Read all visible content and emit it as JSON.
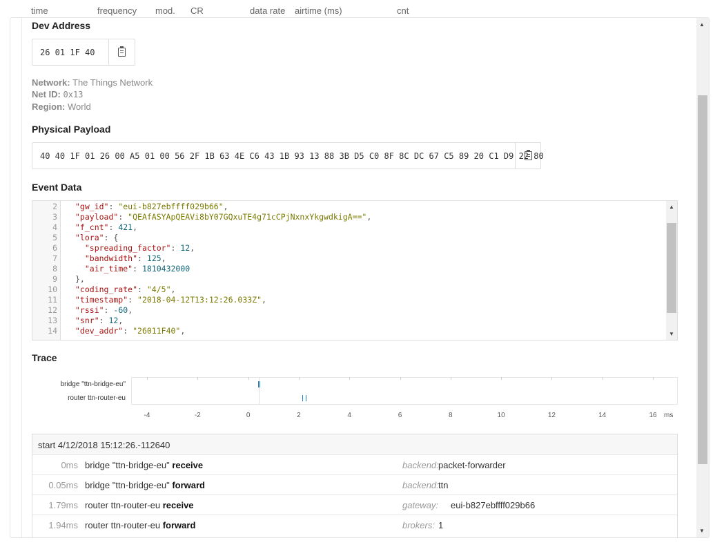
{
  "columns": [
    "time",
    "frequency",
    "mod.",
    "CR",
    "data rate",
    "airtime (ms)",
    "cnt"
  ],
  "dev_address": {
    "heading": "Dev Address",
    "value": "26 01 1F 40"
  },
  "network": {
    "network_label": "Network:",
    "network_value": "The Things Network",
    "netid_label": "Net ID:",
    "netid_value": "0x13",
    "region_label": "Region:",
    "region_value": "World"
  },
  "physical_payload": {
    "heading": "Physical Payload",
    "value": "40 40 1F 01 26 00 A5 01 00 56 2F 1B 63 4E C6 43 1B 93 13 88 3B D5 C0 8F 8C DC 67 C5 89 20 C1 D9 22 80"
  },
  "event_data": {
    "heading": "Event Data",
    "lines": [
      {
        "n": "2",
        "tokens": [
          [
            "k",
            "\"gw_id\""
          ],
          [
            "p",
            ": "
          ],
          [
            "s",
            "\"eui-b827ebffff029b66\""
          ],
          [
            "p",
            ","
          ]
        ]
      },
      {
        "n": "3",
        "tokens": [
          [
            "k",
            "\"payload\""
          ],
          [
            "p",
            ": "
          ],
          [
            "s",
            "\"QEAfASYApQEAVi8bY07GQxuTE4g71cCPjNxnxYkgwdkigA==\""
          ],
          [
            "p",
            ","
          ]
        ]
      },
      {
        "n": "4",
        "tokens": [
          [
            "k",
            "\"f_cnt\""
          ],
          [
            "p",
            ": "
          ],
          [
            "n",
            "421"
          ],
          [
            "p",
            ","
          ]
        ]
      },
      {
        "n": "5",
        "tokens": [
          [
            "k",
            "\"lora\""
          ],
          [
            "p",
            ": {"
          ]
        ]
      },
      {
        "n": "6",
        "tokens": [
          [
            "p",
            "  "
          ],
          [
            "k",
            "\"spreading_factor\""
          ],
          [
            "p",
            ": "
          ],
          [
            "n",
            "12"
          ],
          [
            "p",
            ","
          ]
        ]
      },
      {
        "n": "7",
        "tokens": [
          [
            "p",
            "  "
          ],
          [
            "k",
            "\"bandwidth\""
          ],
          [
            "p",
            ": "
          ],
          [
            "n",
            "125"
          ],
          [
            "p",
            ","
          ]
        ]
      },
      {
        "n": "8",
        "tokens": [
          [
            "p",
            "  "
          ],
          [
            "k",
            "\"air_time\""
          ],
          [
            "p",
            ": "
          ],
          [
            "n",
            "1810432000"
          ]
        ]
      },
      {
        "n": "9",
        "tokens": [
          [
            "p",
            "},"
          ]
        ]
      },
      {
        "n": "10",
        "tokens": [
          [
            "k",
            "\"coding_rate\""
          ],
          [
            "p",
            ": "
          ],
          [
            "s",
            "\"4/5\""
          ],
          [
            "p",
            ","
          ]
        ]
      },
      {
        "n": "11",
        "tokens": [
          [
            "k",
            "\"timestamp\""
          ],
          [
            "p",
            ": "
          ],
          [
            "s",
            "\"2018-04-12T13:12:26.033Z\""
          ],
          [
            "p",
            ","
          ]
        ]
      },
      {
        "n": "12",
        "tokens": [
          [
            "k",
            "\"rssi\""
          ],
          [
            "p",
            ": "
          ],
          [
            "n",
            "-60"
          ],
          [
            "p",
            ","
          ]
        ]
      },
      {
        "n": "13",
        "tokens": [
          [
            "k",
            "\"snr\""
          ],
          [
            "p",
            ": "
          ],
          [
            "n",
            "12"
          ],
          [
            "p",
            ","
          ]
        ]
      },
      {
        "n": "14",
        "tokens": [
          [
            "k",
            "\"dev_addr\""
          ],
          [
            "p",
            ": "
          ],
          [
            "s",
            "\"26011F40\""
          ],
          [
            "p",
            ","
          ]
        ]
      }
    ]
  },
  "trace": {
    "heading": "Trace",
    "lanes": [
      "bridge \"ttn-bridge-eu\"",
      "router ttn-router-eu"
    ],
    "ticks": [
      "-4",
      "-2",
      "0",
      "2",
      "4",
      "6",
      "8",
      "10",
      "12",
      "14",
      "16"
    ],
    "unit": "ms"
  },
  "trace_table": {
    "start": "start 4/12/2018 15:12:26.-112640",
    "rows": [
      {
        "time": "0ms",
        "actor": "bridge \"ttn-bridge-eu\"",
        "event": "receive",
        "key": "backend:",
        "value": "packet-forwarder"
      },
      {
        "time": "0.05ms",
        "actor": "bridge \"ttn-bridge-eu\"",
        "event": "forward",
        "key": "backend:",
        "value": "ttn"
      },
      {
        "time": "1.79ms",
        "actor": "router ttn-router-eu",
        "event": "receive",
        "key": "gateway:",
        "value": "eui-b827ebffff029b66"
      },
      {
        "time": "1.94ms",
        "actor": "router ttn-router-eu",
        "event": "forward",
        "key": "brokers:",
        "value": "1"
      }
    ]
  }
}
